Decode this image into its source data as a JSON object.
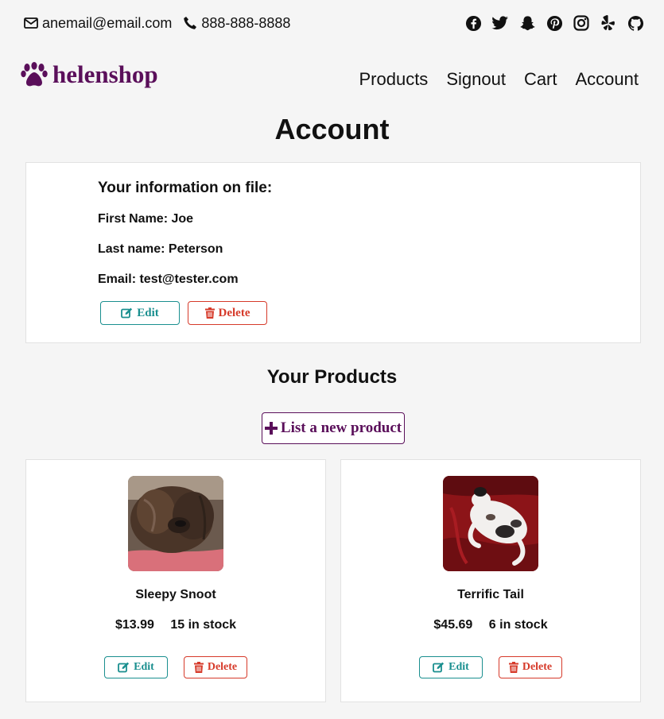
{
  "topbar": {
    "email": "anemail@email.com",
    "phone": "888-888-8888",
    "social": [
      "facebook-icon",
      "twitter-icon",
      "snapchat-icon",
      "pinterest-icon",
      "instagram-icon",
      "yelp-icon",
      "github-icon"
    ]
  },
  "brand": {
    "name": "helenshop",
    "icon": "paw-icon"
  },
  "nav": [
    "Products",
    "Signout",
    "Cart",
    "Account"
  ],
  "page_title": "Account",
  "info": {
    "heading": "Your information on file:",
    "first_name": "First Name: Joe",
    "last_name": "Last name: Peterson",
    "email": "Email: test@tester.com",
    "edit_label": "Edit",
    "delete_label": "Delete"
  },
  "products_section": {
    "title": "Your Products",
    "new_label": "List a new product"
  },
  "products": [
    {
      "name": "Sleepy Snoot",
      "price": "$13.99",
      "stock": "15 in stock",
      "edit_label": "Edit",
      "delete_label": "Delete"
    },
    {
      "name": "Terrific Tail",
      "price": "$45.69",
      "stock": "6 in stock",
      "edit_label": "Edit",
      "delete_label": "Delete"
    }
  ],
  "colors": {
    "brand": "#5a0f5a",
    "edit": "#1a8f8f",
    "delete": "#d63a2a",
    "background": "#f5f5f5"
  }
}
